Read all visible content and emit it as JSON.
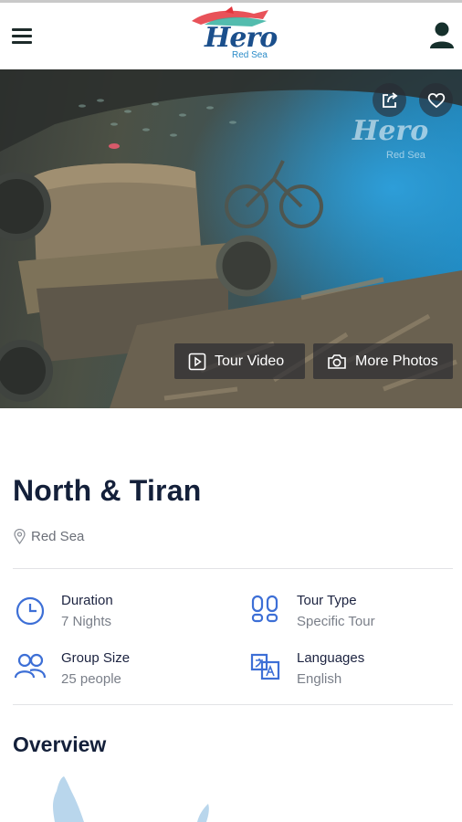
{
  "header": {
    "menu_icon": "hamburger-menu-icon",
    "logo_text": "Hero",
    "logo_sub": "Red Sea",
    "user_icon": "user-icon"
  },
  "hero": {
    "watermark_text": "Hero",
    "watermark_sub": "Red Sea",
    "share_icon": "share-icon",
    "favorite_icon": "heart-icon",
    "video_label": "Tour Video",
    "photos_label": "More Photos"
  },
  "tour": {
    "title": "North & Tiran",
    "location": "Red Sea"
  },
  "details": [
    {
      "label": "Duration",
      "value": "7 Nights",
      "icon": "clock-icon"
    },
    {
      "label": "Tour Type",
      "value": "Specific Tour",
      "icon": "footprints-icon"
    },
    {
      "label": "Group Size",
      "value": "25 people",
      "icon": "group-icon"
    },
    {
      "label": "Languages",
      "value": "English",
      "icon": "translate-icon"
    }
  ],
  "overview": {
    "heading": "Overview"
  },
  "colors": {
    "accent": "#3d6fd6",
    "text": "#14203a",
    "muted": "#7a7f89"
  }
}
